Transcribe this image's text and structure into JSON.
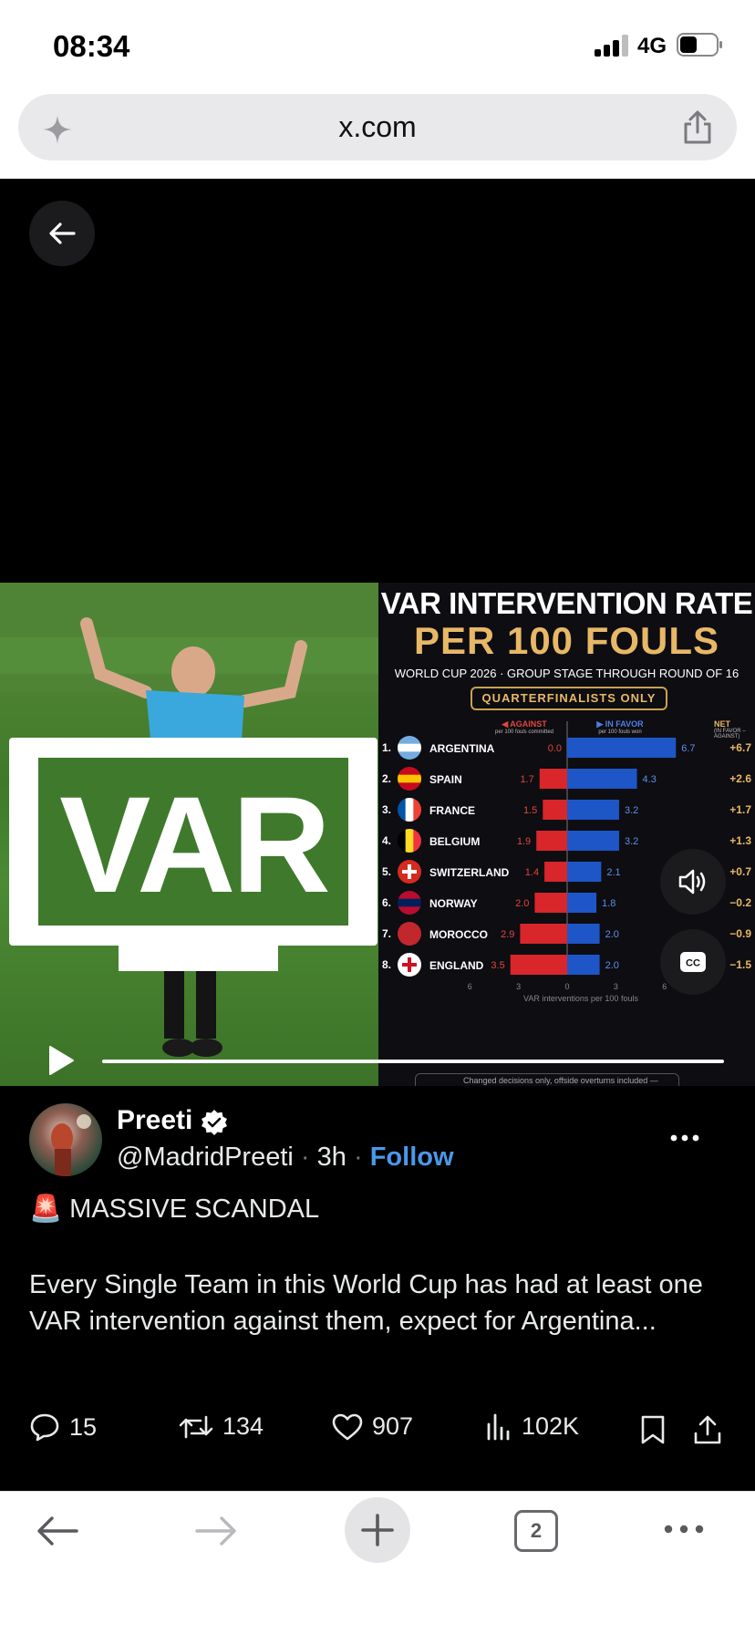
{
  "status_bar": {
    "time": "08:34",
    "network": "4G"
  },
  "browser": {
    "url": "x.com"
  },
  "media": {
    "var_label": "VAR",
    "chart_data": {
      "type": "bar",
      "title": "VAR INTERVENTION RATE",
      "subtitle": "PER 100 FOULS",
      "caption": "WORLD CUP 2026 · GROUP STAGE THROUGH ROUND OF 16",
      "filter": "QUARTERFINALISTS ONLY",
      "against_label": "◀ AGAINST",
      "against_sub": "per 100 fouls committed",
      "favor_label": "▶ IN FAVOR",
      "favor_sub": "per 100 fouls won",
      "net_label": "NET",
      "net_sub": "(IN FAVOR – AGAINST)",
      "xlabel": "VAR interventions per 100 fouls",
      "ticks": [
        "6",
        "3",
        "0",
        "3",
        "6"
      ],
      "footnote": "Changed decisions only, offside overturns included —",
      "categories": [
        "ARGENTINA",
        "SPAIN",
        "FRANCE",
        "BELGIUM",
        "SWITZERLAND",
        "NORWAY",
        "MOROCCO",
        "ENGLAND"
      ],
      "ranks": [
        "1.",
        "2.",
        "3.",
        "4.",
        "5.",
        "6.",
        "7.",
        "8."
      ],
      "series": [
        {
          "name": "AGAINST",
          "values": [
            0.0,
            1.7,
            1.5,
            1.9,
            1.4,
            2.0,
            2.9,
            3.5
          ],
          "labels": [
            "0.0",
            "1.7",
            "1.5",
            "1.9",
            "1.4",
            "2.0",
            "2.9",
            "3.5"
          ],
          "color": "#d8262b"
        },
        {
          "name": "IN FAVOR",
          "values": [
            6.7,
            4.3,
            3.2,
            3.2,
            2.1,
            1.8,
            2.0,
            2.0
          ],
          "labels": [
            "6.7",
            "4.3",
            "3.2",
            "3.2",
            "2.1",
            "1.8",
            "2.0",
            "2.0"
          ],
          "color": "#1e56c8"
        }
      ],
      "net": [
        "+6.7",
        "+2.6",
        "+1.7",
        "+1.3",
        "+0.7",
        "−0.2",
        "−0.9",
        "−1.5"
      ],
      "xlim": [
        -6,
        6
      ],
      "flags": [
        "argentina",
        "spain",
        "france",
        "belgium",
        "switzerland",
        "norway",
        "morocco",
        "england"
      ]
    }
  },
  "tweet": {
    "name": "Preeti",
    "handle": "@MadridPreeti",
    "time": "3h",
    "separator": "·",
    "follow": "Follow",
    "headline": "MASSIVE SCANDAL",
    "headline_emoji": "🚨",
    "body": "Every Single Team in this World Cup has had at least one VAR intervention against them, expect for Argentina...",
    "replies": "15",
    "reposts": "134",
    "likes": "907",
    "views": "102K"
  },
  "toolbar": {
    "tab_count": "2"
  },
  "colors": {
    "link": "#4a99e9",
    "accent_gold": "#e8b866"
  }
}
